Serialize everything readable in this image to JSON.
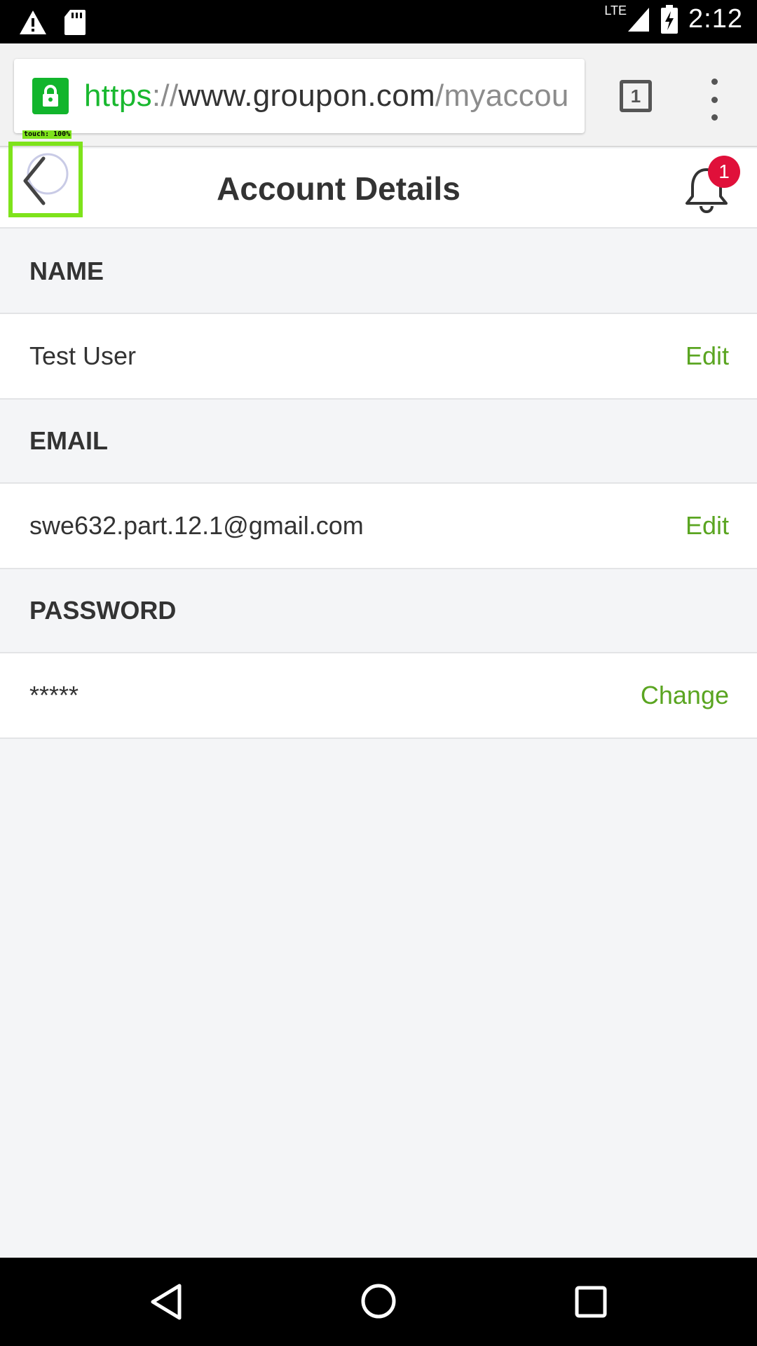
{
  "status_bar": {
    "time": "2:12",
    "network": "LTE",
    "icons": [
      "warning-icon",
      "sd-card-icon",
      "signal-icon",
      "battery-charging-icon"
    ]
  },
  "browser": {
    "url_scheme": "https",
    "url_sep": "://",
    "url_host": "www.groupon.com",
    "url_path": "/myaccount",
    "tab_count": "1"
  },
  "header": {
    "title": "Account Details",
    "touch_label": "touch: 100%",
    "notification_count": "1"
  },
  "sections": [
    {
      "label": "NAME",
      "value": "Test User",
      "action": "Edit"
    },
    {
      "label": "EMAIL",
      "value": "swe632.part.12.1@gmail.com",
      "action": "Edit"
    },
    {
      "label": "PASSWORD",
      "value": "*****",
      "action": "Change"
    }
  ],
  "colors": {
    "accent_green": "#5aa521",
    "lock_green": "#12b52c",
    "badge_red": "#e0103a",
    "touch_highlight": "#7ee31b"
  }
}
